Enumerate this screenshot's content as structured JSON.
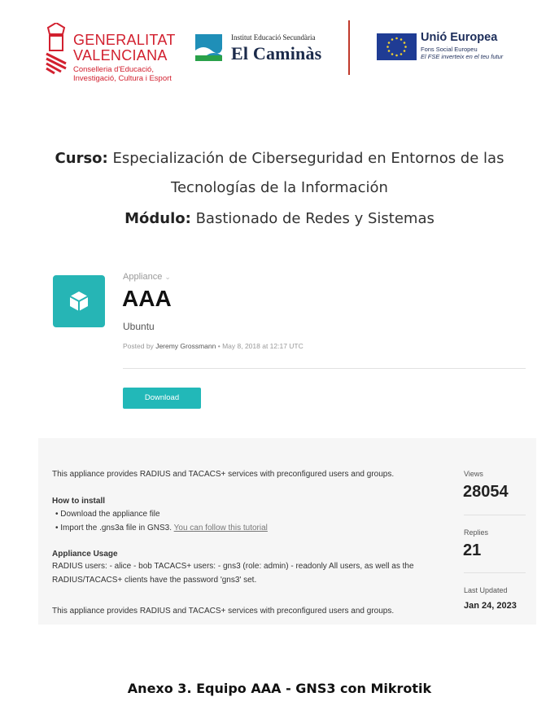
{
  "header": {
    "gv_name_line1": "GENERALITAT",
    "gv_name_line2": "VALENCIANA",
    "gv_sub_line1": "Conselleria d'Educació,",
    "gv_sub_line2": "Investigació, Cultura i Esport",
    "school_small": "Institut Educació Secundària",
    "school_name": "El Caminàs",
    "eu_title": "Unió Europea",
    "eu_sub1": "Fons Social Europeu",
    "eu_sub2": "El FSE inverteix en el teu futur"
  },
  "course": {
    "curso_label": "Curso:",
    "curso_line1": "Especialización de Ciberseguridad en Entornos de las",
    "curso_line2": "Tecnologías de la Información",
    "modulo_label": "Módulo:",
    "modulo_value": "Bastionado de Redes y Sistemas"
  },
  "appliance": {
    "category": "Appliance",
    "title": "AAA",
    "subtitle": "Ubuntu",
    "posted_prefix": "Posted by",
    "author": "Jeremy Grossmann",
    "posted_suffix": "• May 8, 2018 at 12:17 UTC",
    "download_label": "Download"
  },
  "description": {
    "intro": "This appliance provides RADIUS and TACACS+ services with preconfigured users and groups.",
    "install_heading": "How to install",
    "install_item1": "Download the appliance file",
    "install_item2_prefix": "Import the .gns3a file in GNS3.",
    "install_item2_link": "You can follow this tutorial",
    "usage_heading": "Appliance Usage",
    "usage_line1": "RADIUS users: - alice - bob TACACS+ users: - gns3 (role: admin) - readonly All users, as well as the",
    "usage_line2": "RADIUS/TACACS+ clients have the password 'gns3' set.",
    "intro_repeat": "This appliance provides RADIUS and TACACS+ services with preconfigured users and groups."
  },
  "stats": {
    "views_label": "Views",
    "views_value": "28054",
    "replies_label": "Replies",
    "replies_value": "21",
    "updated_label": "Last Updated",
    "updated_value": "Jan 24, 2023"
  },
  "caption": "Anexo 3. Equipo AAA - GNS3 con Mikrotik",
  "colors": {
    "gv_red": "#d2202f",
    "teal": "#22b8b8",
    "eu_blue": "#1f3c94",
    "eu_star": "#f2d22e"
  }
}
